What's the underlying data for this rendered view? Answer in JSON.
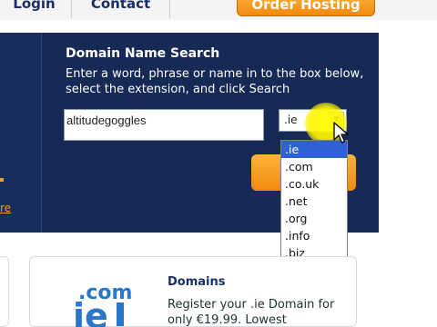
{
  "nav": {
    "login": "Login",
    "contact": "Contact",
    "order_hosting": "Order Hosting"
  },
  "side": {
    "more_link": "re"
  },
  "search_panel": {
    "title": "Domain Name Search",
    "description": "Enter a word, phrase or name in to the box below, select the extension, and click Search",
    "input_value": "altitudegoggles",
    "selected_extension": ".ie",
    "options": [
      ".ie",
      ".com",
      ".co.uk",
      ".net",
      ".org",
      ".info",
      ".biz"
    ]
  },
  "domains_card": {
    "logo_text": ".com",
    "logo_ie": "ie",
    "title": "Domains",
    "description": "Register your .ie Domain for only €19.99. Lowest"
  },
  "colors": {
    "navy": "#162a55",
    "orange": "#f08a10",
    "highlight": "#ffff00",
    "selected_option": "#2e62d3"
  },
  "icons": {
    "select_arrow": "chevron-down-icon",
    "pointer": "cursor-arrow-icon"
  }
}
